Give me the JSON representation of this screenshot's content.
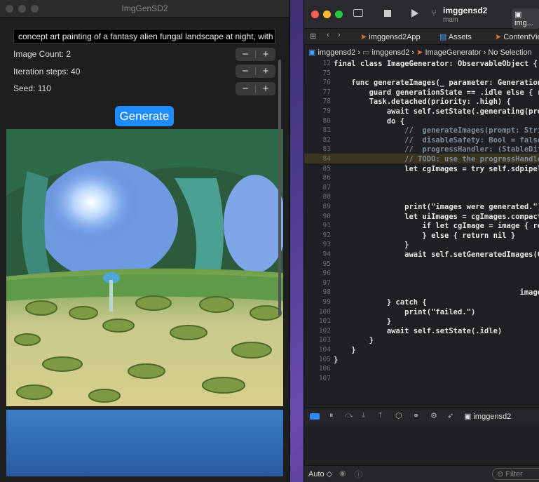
{
  "app": {
    "title": "ImgGenSD2",
    "prompt": "concept art painting of a fantasy alien fungal landscape at night, with glowin...",
    "image_count_label": "Image Count: 2",
    "iteration_label": "Iteration steps: 40",
    "seed_label": "Seed: 110",
    "minus": "−",
    "plus": "+",
    "generate": "Generate"
  },
  "xcode": {
    "scheme": "imggensd2",
    "branch": "main",
    "run_destination": "img...",
    "tabs": [
      "imggensd2App",
      "Assets",
      "ContentView"
    ],
    "breadcrumb": [
      "imggensd2",
      "imggensd2",
      "ImageGenerator",
      "No Selection"
    ],
    "debug_target": "imggensd2",
    "auto_label": "Auto ◇",
    "filter_placeholder": "Filter",
    "code_lines": [
      {
        "n": "12",
        "t": "final class ImageGenerator: ObservableObject {"
      },
      {
        "n": "75",
        "t": ""
      },
      {
        "n": "76",
        "t": "    func generateImages(_ parameter: GenerationPar"
      },
      {
        "n": "77",
        "t": "        guard generationState == .idle else { retu"
      },
      {
        "n": "78",
        "t": "        Task.detached(priority: .high) {"
      },
      {
        "n": "79",
        "t": "            await self.setState(.generating(progre"
      },
      {
        "n": "80",
        "t": "            do {"
      },
      {
        "n": "81",
        "t": "                //  generateImages(prompt: String,"
      },
      {
        "n": "82",
        "t": "                //  disableSafety: Bool = false,"
      },
      {
        "n": "83",
        "t": "                //  progressHandler: (StableDiffus"
      },
      {
        "n": "84",
        "t": "                // TODO: use the progressHandler"
      },
      {
        "n": "85",
        "t": "                let cgImages = try self.sdpipeline"
      },
      {
        "n": "86",
        "t": ""
      },
      {
        "n": "87",
        "t": ""
      },
      {
        "n": "88",
        "t": ""
      },
      {
        "n": "89",
        "t": "                print(\"images were generated.\")"
      },
      {
        "n": "90",
        "t": "                let uiImages = cgImages.compactMap"
      },
      {
        "n": "91",
        "t": "                    if let cgImage = image { retu"
      },
      {
        "n": "92",
        "t": "                    } else { return nil }"
      },
      {
        "n": "93",
        "t": "                }"
      },
      {
        "n": "94",
        "t": "                await self.setGeneratedImages(Gene"
      },
      {
        "n": "95",
        "t": ""
      },
      {
        "n": "96",
        "t": ""
      },
      {
        "n": "97",
        "t": ""
      },
      {
        "n": "98",
        "t": "                                          images:"
      },
      {
        "n": "99",
        "t": "            } catch {"
      },
      {
        "n": "100",
        "t": "                print(\"failed.\")"
      },
      {
        "n": "101",
        "t": "            }"
      },
      {
        "n": "102",
        "t": "            await self.setState(.idle)"
      },
      {
        "n": "103",
        "t": "        }"
      },
      {
        "n": "104",
        "t": "    }"
      },
      {
        "n": "105",
        "t": "}"
      },
      {
        "n": "106",
        "t": ""
      },
      {
        "n": "107",
        "t": ""
      }
    ]
  }
}
